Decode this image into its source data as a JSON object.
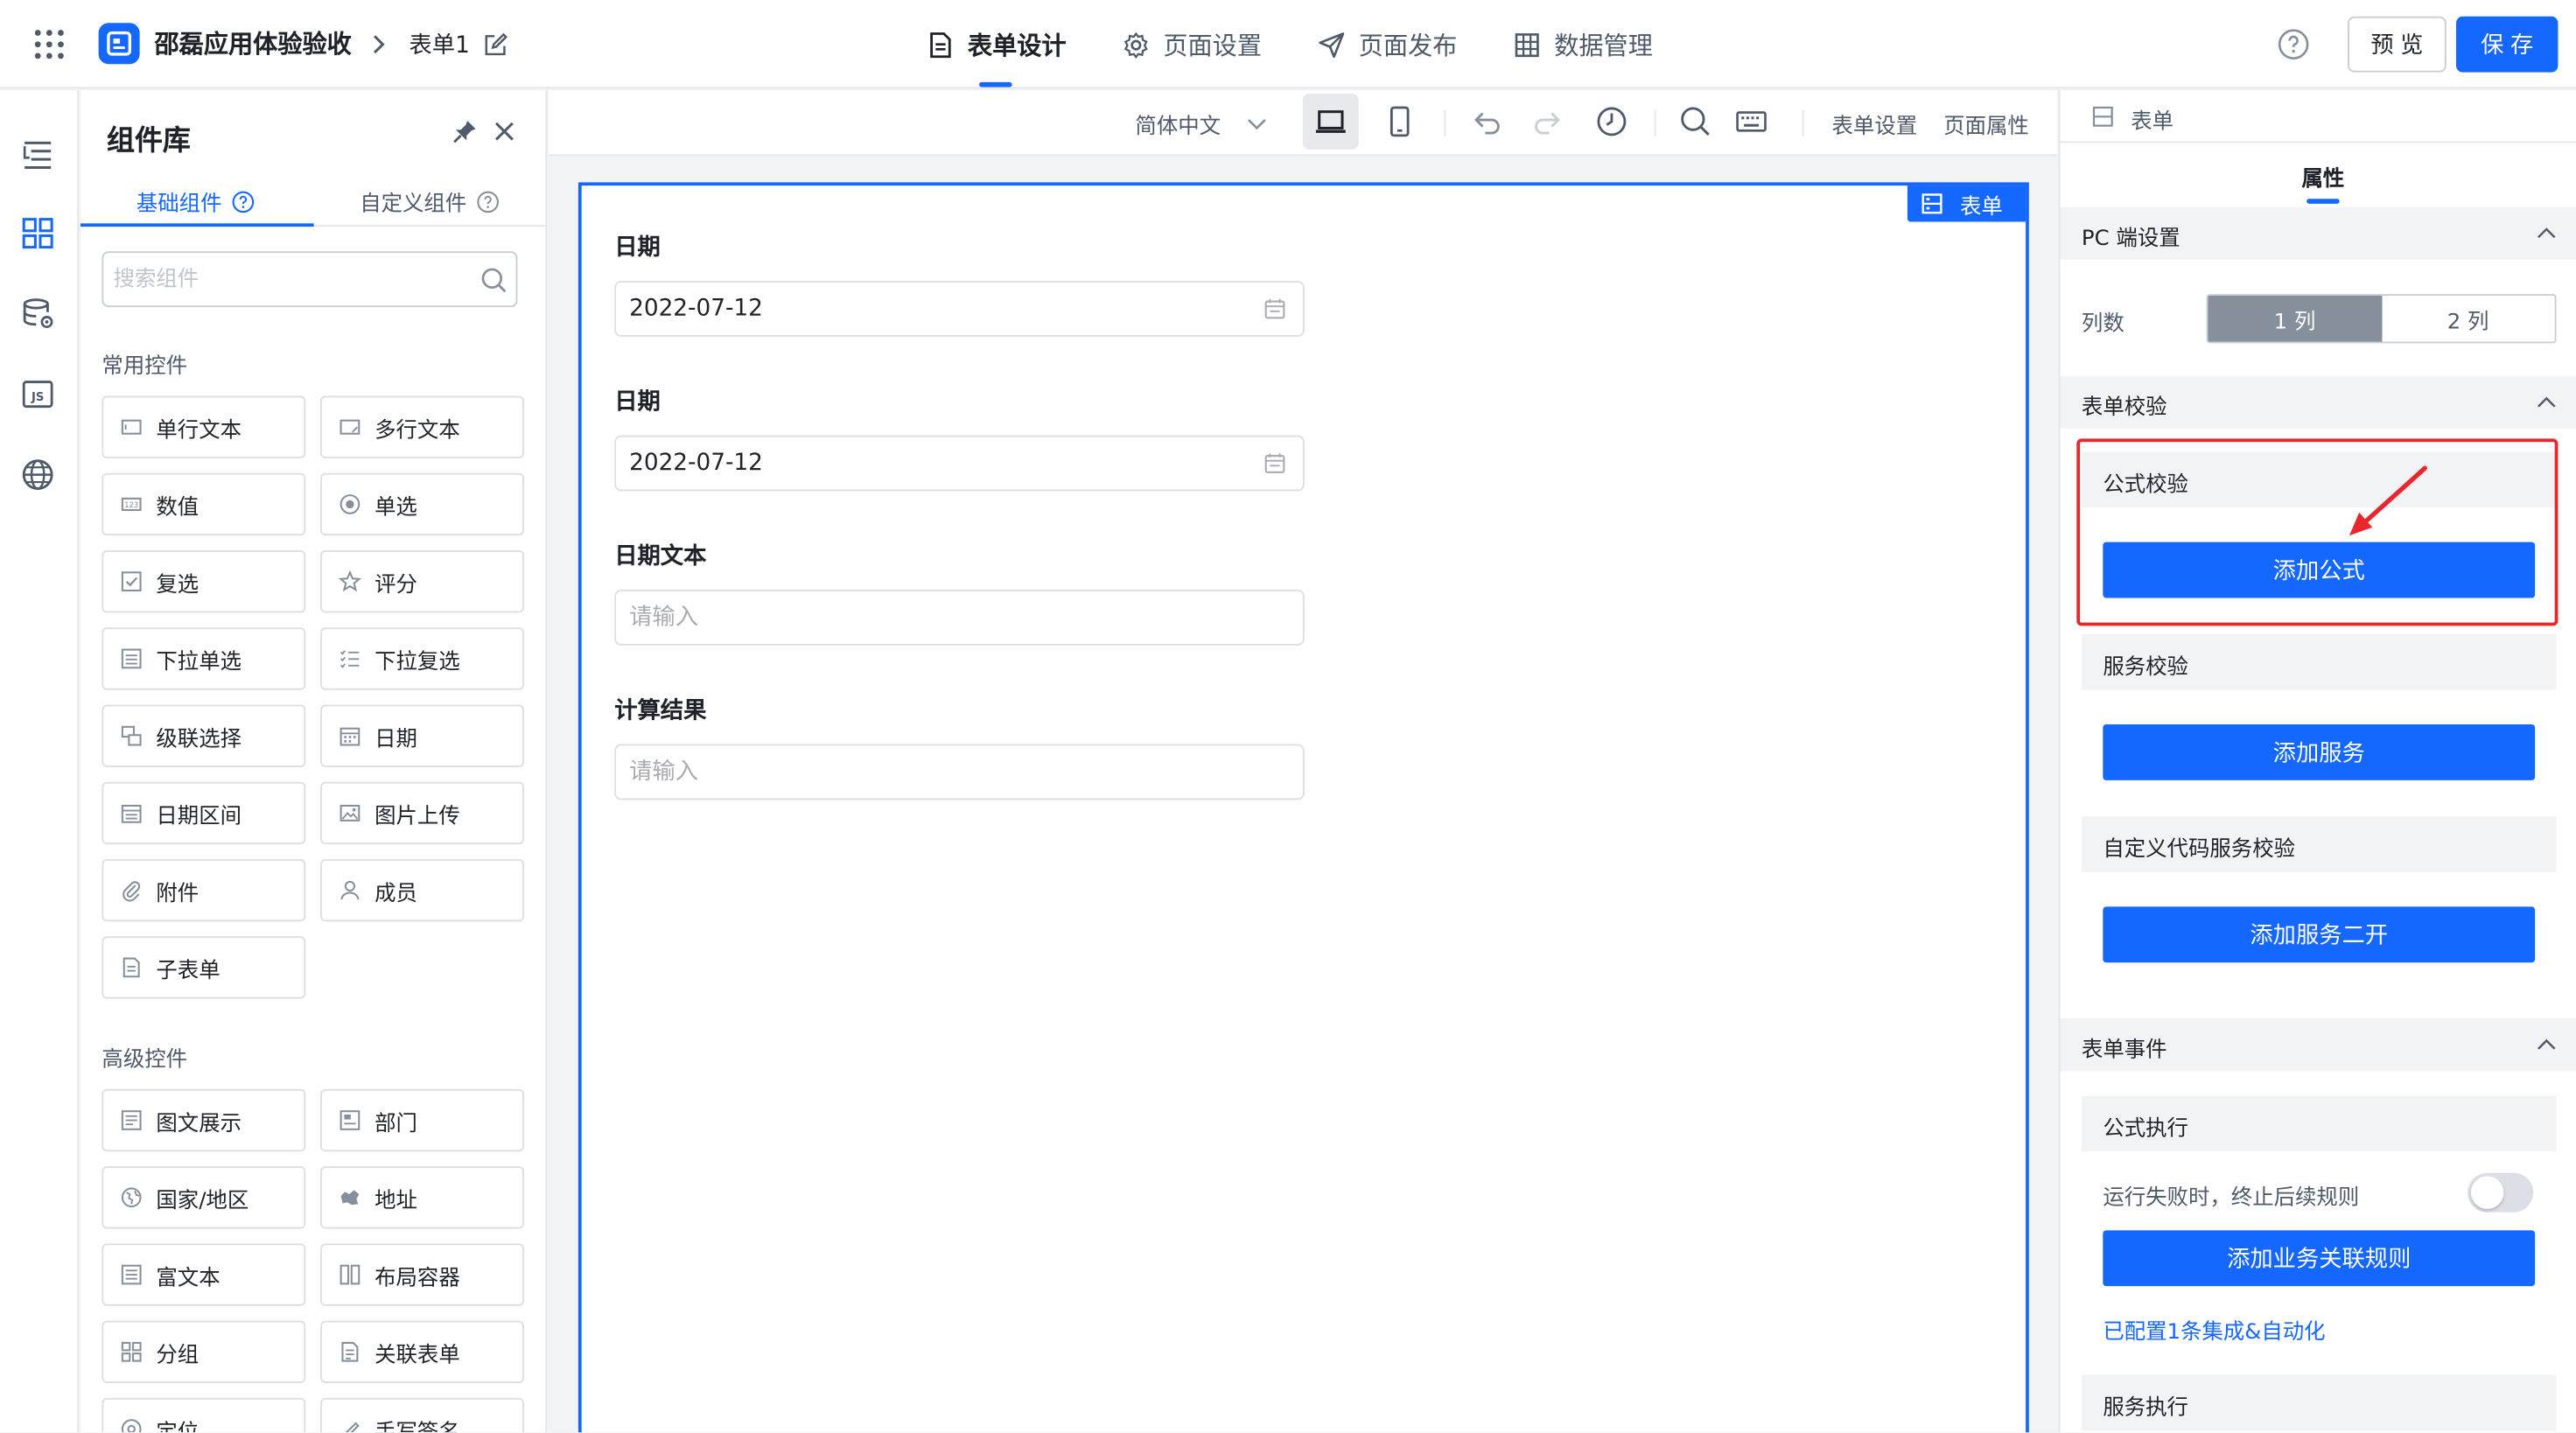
{
  "header": {
    "app_name": "邵磊应用体验验收",
    "form_name": "表单1",
    "tabs": [
      {
        "label": "表单设计",
        "icon": "document-icon"
      },
      {
        "label": "页面设置",
        "icon": "gear-icon"
      },
      {
        "label": "页面发布",
        "icon": "send-icon"
      },
      {
        "label": "数据管理",
        "icon": "table-icon"
      }
    ],
    "active_tab": 0,
    "preview_label": "预览",
    "save_label": "保存"
  },
  "rail": {
    "icons": [
      "outline-icon",
      "components-icon",
      "datasource-icon",
      "js-icon",
      "globe-icon"
    ],
    "active_index": 1
  },
  "library": {
    "title": "组件库",
    "tabs": [
      {
        "label": "基础组件"
      },
      {
        "label": "自定义组件"
      }
    ],
    "active_tab": 0,
    "search_placeholder": "搜索组件",
    "groups": [
      {
        "title": "常用控件",
        "items": [
          {
            "label": "单行文本",
            "icon": "single-line-text-icon"
          },
          {
            "label": "多行文本",
            "icon": "multi-line-text-icon"
          },
          {
            "label": "数值",
            "icon": "number-icon"
          },
          {
            "label": "单选",
            "icon": "radio-icon"
          },
          {
            "label": "复选",
            "icon": "checkbox-icon"
          },
          {
            "label": "评分",
            "icon": "star-icon"
          },
          {
            "label": "下拉单选",
            "icon": "select-icon"
          },
          {
            "label": "下拉复选",
            "icon": "multi-select-icon"
          },
          {
            "label": "级联选择",
            "icon": "cascader-icon"
          },
          {
            "label": "日期",
            "icon": "date-icon"
          },
          {
            "label": "日期区间",
            "icon": "date-range-icon"
          },
          {
            "label": "图片上传",
            "icon": "image-upload-icon"
          },
          {
            "label": "附件",
            "icon": "attachment-icon"
          },
          {
            "label": "成员",
            "icon": "member-icon"
          },
          {
            "label": "子表单",
            "icon": "subform-icon"
          }
        ]
      },
      {
        "title": "高级控件",
        "items": [
          {
            "label": "图文展示",
            "icon": "rich-display-icon"
          },
          {
            "label": "部门",
            "icon": "department-icon"
          },
          {
            "label": "国家/地区",
            "icon": "country-icon"
          },
          {
            "label": "地址",
            "icon": "address-icon"
          },
          {
            "label": "富文本",
            "icon": "rich-text-icon"
          },
          {
            "label": "布局容器",
            "icon": "layout-icon"
          },
          {
            "label": "分组",
            "icon": "group-icon"
          },
          {
            "label": "关联表单",
            "icon": "related-form-icon"
          },
          {
            "label": "定位",
            "icon": "location-icon"
          },
          {
            "label": "手写签名",
            "icon": "signature-icon"
          }
        ]
      }
    ]
  },
  "toolbar": {
    "language": "简体中文",
    "form_settings": "表单设置",
    "page_properties": "页面属性"
  },
  "canvas": {
    "badge": "表单",
    "fields": [
      {
        "label": "日期",
        "value": "2022-07-12",
        "placeholder": "",
        "type": "date"
      },
      {
        "label": "日期",
        "value": "2022-07-12",
        "placeholder": "",
        "type": "date"
      },
      {
        "label": "日期文本",
        "value": "",
        "placeholder": "请输入",
        "type": "text"
      },
      {
        "label": "计算结果",
        "value": "",
        "placeholder": "请输入",
        "type": "text"
      }
    ]
  },
  "props": {
    "breadcrumb": "表单",
    "tab": "属性",
    "pc_settings": {
      "title": "PC 端设置",
      "columns_label": "列数",
      "options": [
        "1 列",
        "2 列"
      ],
      "selected_index": 0
    },
    "validation": {
      "title": "表单校验",
      "formula_title": "公式校验",
      "add_formula": "添加公式",
      "service_title": "服务校验",
      "add_service": "添加服务",
      "custom_title": "自定义代码服务校验",
      "add_custom": "添加服务二开"
    },
    "events": {
      "title": "表单事件",
      "formula_exec_title": "公式执行",
      "stop_on_fail_label": "运行失败时，终止后续规则",
      "stop_on_fail": false,
      "add_rule": "添加业务关联规则",
      "configured_link": "已配置1条集成&自动化",
      "service_exec_title": "服务执行"
    }
  },
  "colors": {
    "primary": "#1467ff",
    "highlight": "#e8262c"
  }
}
